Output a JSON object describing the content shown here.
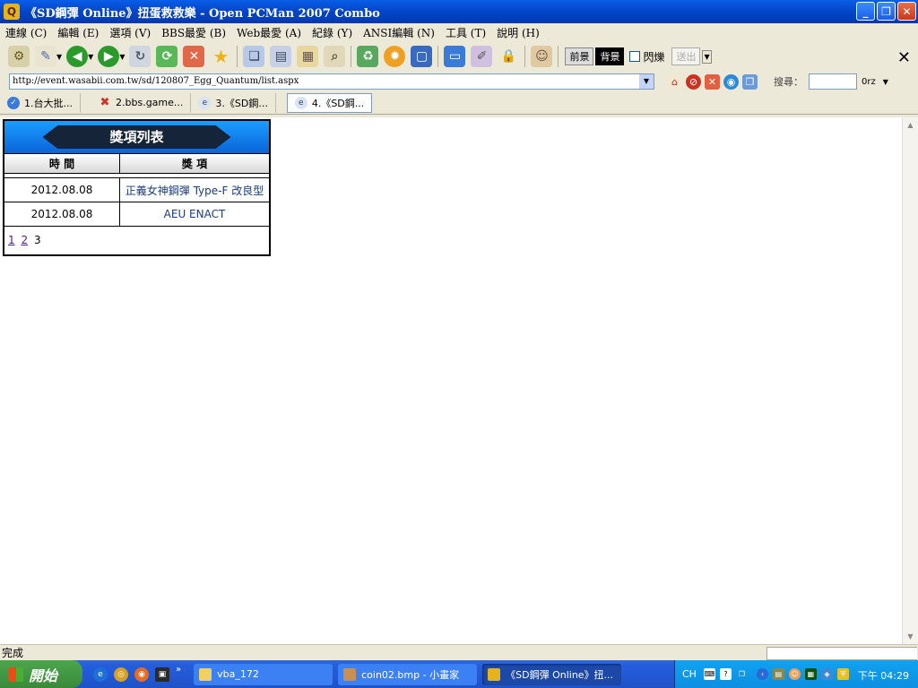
{
  "window": {
    "title": "《SD鋼彈 Online》扭蛋救救樂 - Open PCMan 2007 Combo",
    "app_icon_glyph": "Q"
  },
  "menu": [
    "連線 (C)",
    "編輯 (E)",
    "選項 (V)",
    "BBS最愛 (B)",
    "Web最愛 (A)",
    "紀錄 (Y)",
    "ANSI編輯 (N)",
    "工具 (T)",
    "說明 (H)"
  ],
  "toolbar": {
    "fg_label": "前景",
    "bg_label": "背景",
    "blink_label": "閃爍",
    "send_label": "送出",
    "close_glyph": "✕"
  },
  "address": {
    "url": "http://event.wasabii.com.tw/sd/120807_Egg_Quantum/list.aspx",
    "search_label": "搜尋：",
    "engine": "0rz"
  },
  "tabs": [
    {
      "label": "1.台大批...",
      "active": false
    },
    {
      "label": "2.bbs.game...",
      "active": false
    },
    {
      "label": "3.《SD鋼...",
      "active": false
    },
    {
      "label": "4.《SD鋼...",
      "active": true
    }
  ],
  "prize_list": {
    "title": "獎項列表",
    "col_time": "時 間",
    "col_prize": "獎 項",
    "rows": [
      {
        "time": "2012.08.08",
        "prize": "正義女神鋼彈 Type-F 改良型"
      },
      {
        "time": "2012.08.08",
        "prize": "AEU ENACT"
      }
    ],
    "pages": [
      "1",
      "2",
      "3"
    ]
  },
  "status": {
    "text": "完成"
  },
  "taskbar": {
    "start_label": "開始",
    "tasks": [
      {
        "label": "vba_172",
        "active": false
      },
      {
        "label": "coin02.bmp - 小畫家",
        "active": false
      },
      {
        "label": "《SD鋼彈 Online》扭...",
        "active": true
      }
    ],
    "tray_lang": "CH",
    "clock": "下午 04:29"
  },
  "colors": {
    "titlebar": "#0447c9",
    "header_blue": "#1a9dff",
    "taskbar": "#245edc",
    "start": "#3a8a3a"
  }
}
